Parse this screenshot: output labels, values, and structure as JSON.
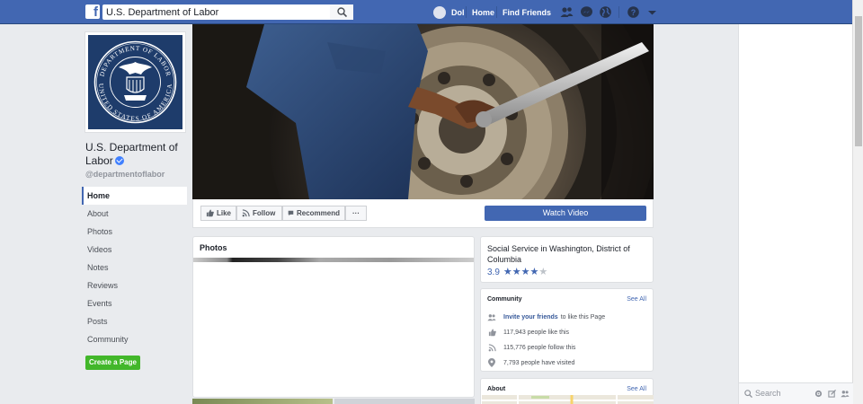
{
  "topbar": {
    "logo_letter": "f",
    "search_value": "U.S. Department of Labor",
    "user_name": "Dol",
    "home_link": "Home",
    "find_friends_link": "Find Friends"
  },
  "page": {
    "name": "U.S. Department of Labor",
    "handle": "@departmentoflabor",
    "seal_text": "DEPARTMENT OF LABOR · UNITED STATES OF AMERICA"
  },
  "left_nav": {
    "items": [
      {
        "label": "Home",
        "active": true
      },
      {
        "label": "About"
      },
      {
        "label": "Photos"
      },
      {
        "label": "Videos"
      },
      {
        "label": "Notes"
      },
      {
        "label": "Reviews"
      },
      {
        "label": "Events"
      },
      {
        "label": "Posts"
      },
      {
        "label": "Community"
      }
    ],
    "create_page_label": "Create a Page"
  },
  "actions": {
    "like": "Like",
    "follow": "Follow",
    "recommend": "Recommend",
    "more": "···",
    "watch_video": "Watch Video"
  },
  "photos_card": {
    "title": "Photos"
  },
  "info_card": {
    "category": "Social Service in Washington, District of Columbia",
    "rating": "3.9",
    "rating_value": 3.9,
    "rating_max": 5
  },
  "community_card": {
    "title": "Community",
    "see_all": "See All",
    "invite_link": "Invite your friends",
    "invite_suffix": "to like this Page",
    "likes": "117,943 people like this",
    "follows": "115,776 people follow this",
    "visits": "7,793 people have visited"
  },
  "about_card": {
    "title": "About",
    "see_all": "See All"
  },
  "chat": {
    "search_placeholder": "Search"
  },
  "colors": {
    "brand_blue": "#4267b2",
    "create_green": "#42b72a",
    "background": "#e9ebee"
  }
}
